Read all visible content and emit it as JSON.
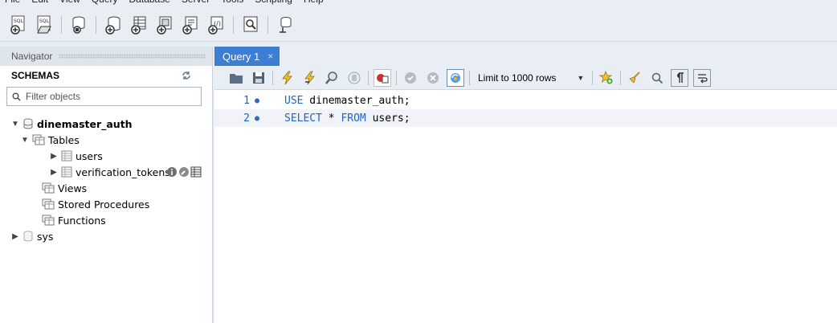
{
  "menu": [
    "File",
    "Edit",
    "View",
    "Query",
    "Database",
    "Server",
    "Tools",
    "Scripting",
    "Help"
  ],
  "navigator": {
    "title": "Navigator",
    "schemas_label": "SCHEMAS",
    "filter_placeholder": "Filter objects",
    "tree": {
      "schema1": "dinemaster_auth",
      "tables": "Tables",
      "table1": "users",
      "table2": "verification_tokens",
      "views": "Views",
      "procs": "Stored Procedures",
      "funcs": "Functions",
      "schema2": "sys"
    }
  },
  "editor": {
    "tab_title": "Query 1",
    "tab_close": "×",
    "limit_label": "Limit to 1000 rows",
    "lines": [
      {
        "num": "1",
        "keyword": "USE",
        "rest": " dinemaster_auth;"
      },
      {
        "num": "2",
        "keyword": "SELECT",
        "star": " * ",
        "keyword2": "FROM",
        "rest": " users;"
      }
    ]
  }
}
